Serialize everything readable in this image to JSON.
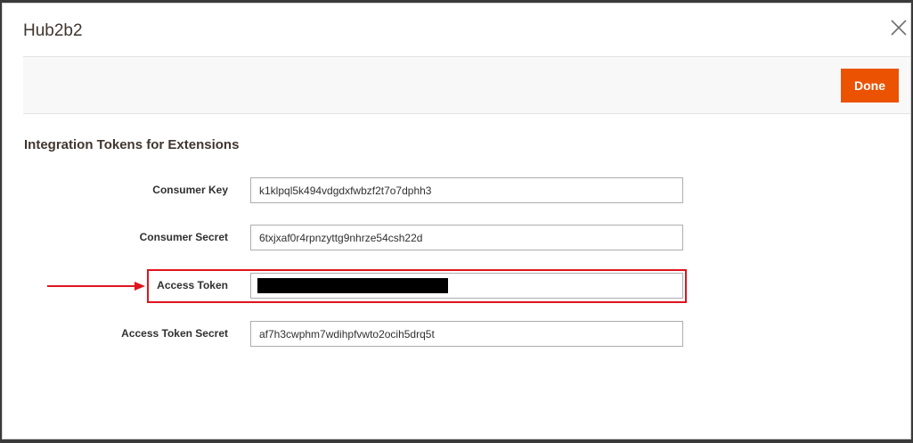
{
  "modal": {
    "title": "Hub2b2"
  },
  "actions": {
    "done_label": "Done"
  },
  "section": {
    "title": "Integration Tokens for Extensions"
  },
  "fields": {
    "consumer_key": {
      "label": "Consumer Key",
      "value": "k1klpql5k494vdgdxfwbzf2t7o7dphh3"
    },
    "consumer_secret": {
      "label": "Consumer Secret",
      "value": "6txjxaf0r4rpnzyttg9nhrze54csh22d"
    },
    "access_token": {
      "label": "Access Token",
      "value": ""
    },
    "access_token_secret": {
      "label": "Access Token Secret",
      "value": "af7h3cwphm7wdihpfvwto2ocih5drq5t"
    }
  },
  "colors": {
    "accent": "#eb5202",
    "annotation": "#e0141e"
  },
  "icons": {
    "close": "close-icon",
    "arrow": "arrow-right-icon"
  }
}
